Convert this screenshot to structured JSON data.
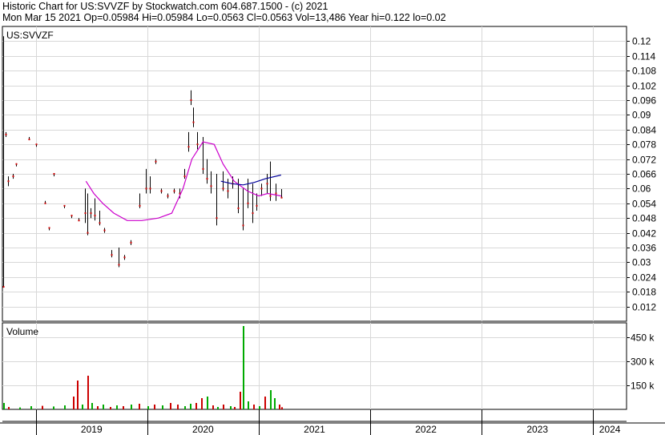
{
  "header": {
    "line1": "Historic Chart for US:SVVZF by Stockwatch.com 604.687.1500 - (c) 2021",
    "line2": "Mon Mar 15 2021   Op=0.05984   Hi=0.05984   Lo=0.0563   Cl=0.0563   Vol=13,486   Year hi=0.122   lo=0.02"
  },
  "colors": {
    "background": "#ffffff",
    "grid": "#d8d8d8",
    "price_bar": "#000000",
    "down_close": "#cc0000",
    "ma_long": "#cc00cc",
    "ma_short": "#000099",
    "volume_up": "#00aa00",
    "volume_down": "#cc0000"
  },
  "chart_data": [
    {
      "type": "line",
      "title": "US:SVVZF",
      "ylim": [
        0.006,
        0.126
      ],
      "y_ticks": [
        "0.12",
        "0.114",
        "0.108",
        "0.102",
        "0.096",
        "0.09",
        "0.084",
        "0.078",
        "0.072",
        "0.066",
        "0.06",
        "0.054",
        "0.048",
        "0.042",
        "0.036",
        "0.03",
        "0.024",
        "0.018",
        "0.012"
      ],
      "x_ticks": [
        "2019",
        "2020",
        "2021",
        "2022",
        "2023",
        "2024"
      ],
      "x_range": [
        2018.7,
        2024.3
      ],
      "grid": true,
      "series": [
        {
          "kind": "ohlc",
          "values": [
            {
              "x": 2018.71,
              "hi": 0.122,
              "lo": 0.02,
              "cl": 0.02
            },
            {
              "x": 2018.73,
              "hi": 0.083,
              "lo": 0.081,
              "cl": 0.082
            },
            {
              "x": 2018.75,
              "hi": 0.065,
              "lo": 0.061,
              "cl": 0.063
            },
            {
              "x": 2018.79,
              "hi": 0.066,
              "lo": 0.064,
              "cl": 0.065
            },
            {
              "x": 2018.82,
              "hi": 0.07,
              "lo": 0.069,
              "cl": 0.07
            },
            {
              "x": 2018.94,
              "hi": 0.081,
              "lo": 0.08,
              "cl": 0.08
            },
            {
              "x": 2019.0,
              "hi": 0.078,
              "lo": 0.077,
              "cl": 0.078
            },
            {
              "x": 2019.08,
              "hi": 0.055,
              "lo": 0.054,
              "cl": 0.054
            },
            {
              "x": 2019.12,
              "hi": 0.044,
              "lo": 0.043,
              "cl": 0.044
            },
            {
              "x": 2019.16,
              "hi": 0.066,
              "lo": 0.065,
              "cl": 0.066
            },
            {
              "x": 2019.25,
              "hi": 0.053,
              "lo": 0.052,
              "cl": 0.053
            },
            {
              "x": 2019.32,
              "hi": 0.049,
              "lo": 0.048,
              "cl": 0.049
            },
            {
              "x": 2019.38,
              "hi": 0.048,
              "lo": 0.047,
              "cl": 0.047
            },
            {
              "x": 2019.44,
              "hi": 0.06,
              "lo": 0.046,
              "cl": 0.05
            },
            {
              "x": 2019.46,
              "hi": 0.058,
              "lo": 0.041,
              "cl": 0.042
            },
            {
              "x": 2019.49,
              "hi": 0.052,
              "lo": 0.048,
              "cl": 0.05
            },
            {
              "x": 2019.53,
              "hi": 0.056,
              "lo": 0.047,
              "cl": 0.049
            },
            {
              "x": 2019.57,
              "hi": 0.051,
              "lo": 0.045,
              "cl": 0.046
            },
            {
              "x": 2019.61,
              "hi": 0.044,
              "lo": 0.042,
              "cl": 0.043
            },
            {
              "x": 2019.68,
              "hi": 0.035,
              "lo": 0.032,
              "cl": 0.033
            },
            {
              "x": 2019.74,
              "hi": 0.036,
              "lo": 0.028,
              "cl": 0.029
            },
            {
              "x": 2019.79,
              "hi": 0.033,
              "lo": 0.031,
              "cl": 0.032
            },
            {
              "x": 2019.85,
              "hi": 0.039,
              "lo": 0.037,
              "cl": 0.038
            },
            {
              "x": 2019.93,
              "hi": 0.058,
              "lo": 0.052,
              "cl": 0.053
            },
            {
              "x": 2019.99,
              "hi": 0.068,
              "lo": 0.058,
              "cl": 0.06
            },
            {
              "x": 2020.02,
              "hi": 0.065,
              "lo": 0.058,
              "cl": 0.06
            },
            {
              "x": 2020.07,
              "hi": 0.072,
              "lo": 0.07,
              "cl": 0.071
            },
            {
              "x": 2020.12,
              "hi": 0.06,
              "lo": 0.058,
              "cl": 0.059
            },
            {
              "x": 2020.18,
              "hi": 0.058,
              "lo": 0.056,
              "cl": 0.057
            },
            {
              "x": 2020.24,
              "hi": 0.06,
              "lo": 0.058,
              "cl": 0.059
            },
            {
              "x": 2020.29,
              "hi": 0.06,
              "lo": 0.056,
              "cl": 0.058
            },
            {
              "x": 2020.33,
              "hi": 0.068,
              "lo": 0.064,
              "cl": 0.065
            },
            {
              "x": 2020.37,
              "hi": 0.083,
              "lo": 0.075,
              "cl": 0.077
            },
            {
              "x": 2020.39,
              "hi": 0.1,
              "lo": 0.094,
              "cl": 0.096
            },
            {
              "x": 2020.41,
              "hi": 0.093,
              "lo": 0.085,
              "cl": 0.087
            },
            {
              "x": 2020.45,
              "hi": 0.083,
              "lo": 0.076,
              "cl": 0.078
            },
            {
              "x": 2020.5,
              "hi": 0.081,
              "lo": 0.066,
              "cl": 0.068
            },
            {
              "x": 2020.53,
              "hi": 0.072,
              "lo": 0.062,
              "cl": 0.064
            },
            {
              "x": 2020.57,
              "hi": 0.067,
              "lo": 0.058,
              "cl": 0.061
            },
            {
              "x": 2020.62,
              "hi": 0.066,
              "lo": 0.045,
              "cl": 0.048
            },
            {
              "x": 2020.68,
              "hi": 0.067,
              "lo": 0.059,
              "cl": 0.06
            },
            {
              "x": 2020.72,
              "hi": 0.064,
              "lo": 0.056,
              "cl": 0.059
            },
            {
              "x": 2020.76,
              "hi": 0.065,
              "lo": 0.06,
              "cl": 0.062
            },
            {
              "x": 2020.81,
              "hi": 0.064,
              "lo": 0.05,
              "cl": 0.052
            },
            {
              "x": 2020.86,
              "hi": 0.06,
              "lo": 0.043,
              "cl": 0.045
            },
            {
              "x": 2020.9,
              "hi": 0.064,
              "lo": 0.052,
              "cl": 0.054
            },
            {
              "x": 2020.94,
              "hi": 0.062,
              "lo": 0.046,
              "cl": 0.05
            },
            {
              "x": 2020.98,
              "hi": 0.058,
              "lo": 0.051,
              "cl": 0.053
            },
            {
              "x": 2021.02,
              "hi": 0.062,
              "lo": 0.057,
              "cl": 0.06
            },
            {
              "x": 2021.07,
              "hi": 0.066,
              "lo": 0.058,
              "cl": 0.062
            },
            {
              "x": 2021.1,
              "hi": 0.071,
              "lo": 0.055,
              "cl": 0.057
            },
            {
              "x": 2021.15,
              "hi": 0.062,
              "lo": 0.055,
              "cl": 0.058
            },
            {
              "x": 2021.2,
              "hi": 0.0598,
              "lo": 0.0563,
              "cl": 0.0563
            }
          ]
        },
        {
          "kind": "moving_average_long",
          "values": [
            {
              "x": 2019.45,
              "y": 0.063
            },
            {
              "x": 2019.52,
              "y": 0.058
            },
            {
              "x": 2019.6,
              "y": 0.054
            },
            {
              "x": 2019.7,
              "y": 0.05
            },
            {
              "x": 2019.82,
              "y": 0.047
            },
            {
              "x": 2019.95,
              "y": 0.047
            },
            {
              "x": 2020.1,
              "y": 0.048
            },
            {
              "x": 2020.22,
              "y": 0.05
            },
            {
              "x": 2020.32,
              "y": 0.06
            },
            {
              "x": 2020.4,
              "y": 0.072
            },
            {
              "x": 2020.5,
              "y": 0.079
            },
            {
              "x": 2020.6,
              "y": 0.078
            },
            {
              "x": 2020.68,
              "y": 0.07
            },
            {
              "x": 2020.78,
              "y": 0.063
            },
            {
              "x": 2020.9,
              "y": 0.059
            },
            {
              "x": 2021.0,
              "y": 0.057
            },
            {
              "x": 2021.08,
              "y": 0.058
            },
            {
              "x": 2021.2,
              "y": 0.057
            }
          ]
        },
        {
          "kind": "moving_average_short",
          "values": [
            {
              "x": 2020.66,
              "y": 0.063
            },
            {
              "x": 2020.76,
              "y": 0.062
            },
            {
              "x": 2020.86,
              "y": 0.0615
            },
            {
              "x": 2020.96,
              "y": 0.0625
            },
            {
              "x": 2021.06,
              "y": 0.064
            },
            {
              "x": 2021.2,
              "y": 0.0655
            }
          ]
        }
      ]
    },
    {
      "type": "bar",
      "title": "Volume",
      "ylim": [
        0,
        540000
      ],
      "y_ticks": [
        "450 k",
        "300 k",
        "150 k"
      ],
      "x_range": [
        2018.7,
        2024.3
      ],
      "series": [
        {
          "name": "Volume",
          "values": [
            {
              "x": 2018.71,
              "v": 40000,
              "up": true
            },
            {
              "x": 2018.75,
              "v": 15000,
              "up": false
            },
            {
              "x": 2018.85,
              "v": 12000,
              "up": true
            },
            {
              "x": 2018.95,
              "v": 20000,
              "up": true
            },
            {
              "x": 2019.05,
              "v": 22000,
              "up": false
            },
            {
              "x": 2019.15,
              "v": 18000,
              "up": true
            },
            {
              "x": 2019.25,
              "v": 25000,
              "up": true
            },
            {
              "x": 2019.33,
              "v": 80000,
              "up": false
            },
            {
              "x": 2019.37,
              "v": 180000,
              "up": false
            },
            {
              "x": 2019.41,
              "v": 30000,
              "up": true
            },
            {
              "x": 2019.46,
              "v": 210000,
              "up": false
            },
            {
              "x": 2019.5,
              "v": 40000,
              "up": true
            },
            {
              "x": 2019.55,
              "v": 20000,
              "up": false
            },
            {
              "x": 2019.6,
              "v": 30000,
              "up": true
            },
            {
              "x": 2019.66,
              "v": 15000,
              "up": false
            },
            {
              "x": 2019.72,
              "v": 25000,
              "up": true
            },
            {
              "x": 2019.78,
              "v": 20000,
              "up": false
            },
            {
              "x": 2019.85,
              "v": 30000,
              "up": true
            },
            {
              "x": 2019.92,
              "v": 35000,
              "up": false
            },
            {
              "x": 2020.0,
              "v": 20000,
              "up": true
            },
            {
              "x": 2020.06,
              "v": 30000,
              "up": false
            },
            {
              "x": 2020.13,
              "v": 25000,
              "up": true
            },
            {
              "x": 2020.2,
              "v": 40000,
              "up": false
            },
            {
              "x": 2020.27,
              "v": 30000,
              "up": false
            },
            {
              "x": 2020.33,
              "v": 20000,
              "up": true
            },
            {
              "x": 2020.38,
              "v": 35000,
              "up": true
            },
            {
              "x": 2020.43,
              "v": 40000,
              "up": false
            },
            {
              "x": 2020.48,
              "v": 70000,
              "up": false
            },
            {
              "x": 2020.53,
              "v": 80000,
              "up": true
            },
            {
              "x": 2020.58,
              "v": 25000,
              "up": false
            },
            {
              "x": 2020.63,
              "v": 15000,
              "up": true
            },
            {
              "x": 2020.68,
              "v": 30000,
              "up": false
            },
            {
              "x": 2020.74,
              "v": 20000,
              "up": true
            },
            {
              "x": 2020.78,
              "v": 15000,
              "up": false
            },
            {
              "x": 2020.83,
              "v": 110000,
              "up": false
            },
            {
              "x": 2020.86,
              "v": 520000,
              "up": true
            },
            {
              "x": 2020.9,
              "v": 50000,
              "up": true
            },
            {
              "x": 2020.95,
              "v": 30000,
              "up": false
            },
            {
              "x": 2021.0,
              "v": 20000,
              "up": true
            },
            {
              "x": 2021.05,
              "v": 80000,
              "up": false
            },
            {
              "x": 2021.1,
              "v": 120000,
              "up": true
            },
            {
              "x": 2021.14,
              "v": 70000,
              "up": true
            },
            {
              "x": 2021.18,
              "v": 30000,
              "up": false
            },
            {
              "x": 2021.2,
              "v": 13486,
              "up": false
            }
          ]
        }
      ]
    }
  ]
}
